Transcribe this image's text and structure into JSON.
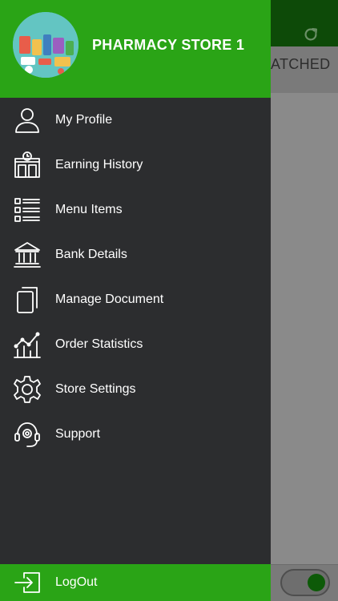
{
  "header": {
    "store_name": "PHARMACY STORE 1",
    "avatar_logo_text": "Medicine"
  },
  "background": {
    "tab_partial_label": "ATCHED"
  },
  "menu": {
    "items": [
      {
        "label": "My Profile",
        "icon": "user-icon"
      },
      {
        "label": "Earning History",
        "icon": "store-clock-icon"
      },
      {
        "label": "Menu Items",
        "icon": "list-icon"
      },
      {
        "label": "Bank Details",
        "icon": "bank-icon"
      },
      {
        "label": "Manage Document",
        "icon": "documents-icon"
      },
      {
        "label": "Order Statistics",
        "icon": "chart-icon"
      },
      {
        "label": "Store Settings",
        "icon": "gear-icon"
      },
      {
        "label": "Support",
        "icon": "headset-icon"
      }
    ]
  },
  "logout": {
    "label": "LogOut",
    "icon": "logout-icon"
  },
  "colors": {
    "accent_green": "#2aa416",
    "drawer_bg": "#2c2d2f",
    "appbar_dark": "#0d4a08"
  }
}
